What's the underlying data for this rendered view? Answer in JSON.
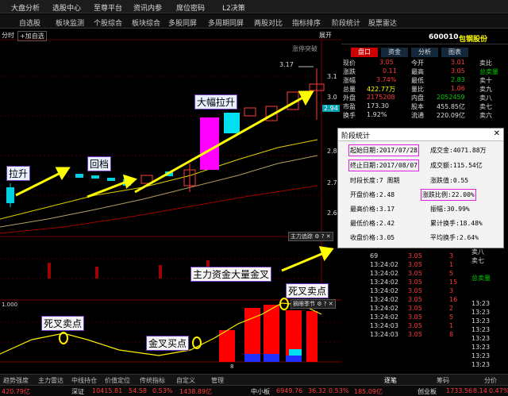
{
  "menu": [
    "大盘分析",
    "选股中心",
    "至尊平台",
    "资讯内参",
    "席位密码",
    "L2决策"
  ],
  "tabs": [
    "自选股",
    "板块监测",
    "个股综合",
    "板块综合",
    "多股同屏",
    "多周期同屏",
    "两股对比",
    "指标排序",
    "阶段统计",
    "股票雷达"
  ],
  "chart_header": {
    "tab": "分时",
    "add": "+加自选",
    "right": "展开",
    "label": "涨停突破"
  },
  "price_axis": [
    "3.1",
    "3.0",
    "2.94",
    "2.8",
    "2.7",
    "2.6"
  ],
  "price_top": "3.17",
  "indicator": {
    "label": "主力追踪",
    "label2": "摘眼季节",
    "value": "1.000",
    "tick": "8"
  },
  "annotations": {
    "a1": "拉升",
    "a2": "回档",
    "a3": "大幅拉升",
    "a4": "主力资金大量金叉",
    "a5": "死叉卖点",
    "a6": "死叉卖点",
    "a7": "金叉买点"
  },
  "stock": {
    "code": "600010",
    "name": "包钢股份"
  },
  "side_tabs": [
    "盘口",
    "资金",
    "分析",
    "图表"
  ],
  "quote": [
    {
      "l": "现价",
      "v": "3.05",
      "l2": "今开",
      "v2": "3.01"
    },
    {
      "l": "涨跌",
      "v": "0.11",
      "l2": "最高",
      "v2": "3.05"
    },
    {
      "l": "涨幅",
      "v": "3.74%",
      "l2": "最低",
      "v2": "2.83"
    },
    {
      "l": "总量",
      "v": "422.77万",
      "l2": "量比",
      "v2": "1.06"
    },
    {
      "l": "外盘",
      "v": "2175208",
      "l2": "内盘",
      "v2": "2052459"
    },
    {
      "l": "市盈",
      "v": "173.30",
      "l2": "股本",
      "v2": "455.85亿"
    },
    {
      "l": "换手",
      "v": "1.92%",
      "l2": "流通",
      "v2": "220.09亿"
    }
  ],
  "orderbook": [
    "卖七",
    "卖八",
    "卖九",
    "卖十"
  ],
  "orderbook_top": [
    "卖比",
    "总卖量",
    "卖十",
    "卖九",
    "卖八",
    "卖七",
    "卖六"
  ],
  "dialog": {
    "title": "阶段统计",
    "start_label": "起始日期:",
    "start": "2017/07/28",
    "end_label": "终止日期:",
    "end": "2017/08/07",
    "period": "时段长度:7 周期",
    "open": "开盘价格:2.48",
    "high": "最高价格:3.17",
    "low": "最低价格:2.42",
    "close": "收盘价格:3.05",
    "amount": "成交金:4071.88万",
    "vol": "成交额:115.54亿",
    "ratio_label": "涨跌值:0.55",
    "ratio": "涨跌比例:22.00%",
    "amp": "振幅:30.99%",
    "turnover": "累计换手:18.48%",
    "avg": "平均换手:2.64%"
  },
  "ticks": [
    {
      "t": "13:24:02",
      "p": "3.05",
      "v": "69",
      "d": "3"
    },
    {
      "t": "13:24:02",
      "p": "3.05",
      "v": "",
      "d": "1"
    },
    {
      "t": "13:24:02",
      "p": "3.05",
      "v": "",
      "d": "5"
    },
    {
      "t": "13:24:02",
      "p": "3.05",
      "v": "",
      "d": "15"
    },
    {
      "t": "13:24:02",
      "p": "3.05",
      "v": "",
      "d": "3"
    },
    {
      "t": "13:24:02",
      "p": "3.05",
      "v": "",
      "d": "16"
    },
    {
      "t": "13:24:02",
      "p": "3.05",
      "v": "",
      "d": "2"
    },
    {
      "t": "13:24:02",
      "p": "3.05",
      "v": "",
      "d": "5"
    },
    {
      "t": "13:24:03",
      "p": "3.05",
      "v": "",
      "d": "1"
    },
    {
      "t": "13:24:03",
      "p": "3.05",
      "v": "",
      "d": "8"
    }
  ],
  "small_times": [
    "13:23",
    "13:23",
    "13:23",
    "13:23",
    "13:23",
    "13:23",
    "13:23",
    "13:23"
  ],
  "bottom_tabs": [
    "趋势强度",
    "主力雷达",
    "中线持仓",
    "价值定位",
    "传统指标",
    "自定义",
    "管理"
  ],
  "status": {
    "sh_label": "420.79亿",
    "sz_label": "深证",
    "sz": "10415.81",
    "sz_chg": "54.58",
    "sz_pct": "0.53%",
    "sz_amt": "1438.89亿",
    "zxb": "中小板",
    "zxb_v": "6949.76",
    "zxb_chg": "36.32",
    "zxb_pct": "0.53%",
    "zxb_amt": "185.09亿",
    "cyb": "创业板",
    "cyb_v": "1733.56",
    "cyb_chg": "8.14",
    "cyb_pct": "0.47%"
  },
  "right_tabs": [
    "逐笔",
    "筹码",
    "分价"
  ],
  "colors": {
    "up": "#ff3a3a",
    "down": "#00c8d0",
    "accent": "#ffff00",
    "highlight": "#e020e0"
  }
}
